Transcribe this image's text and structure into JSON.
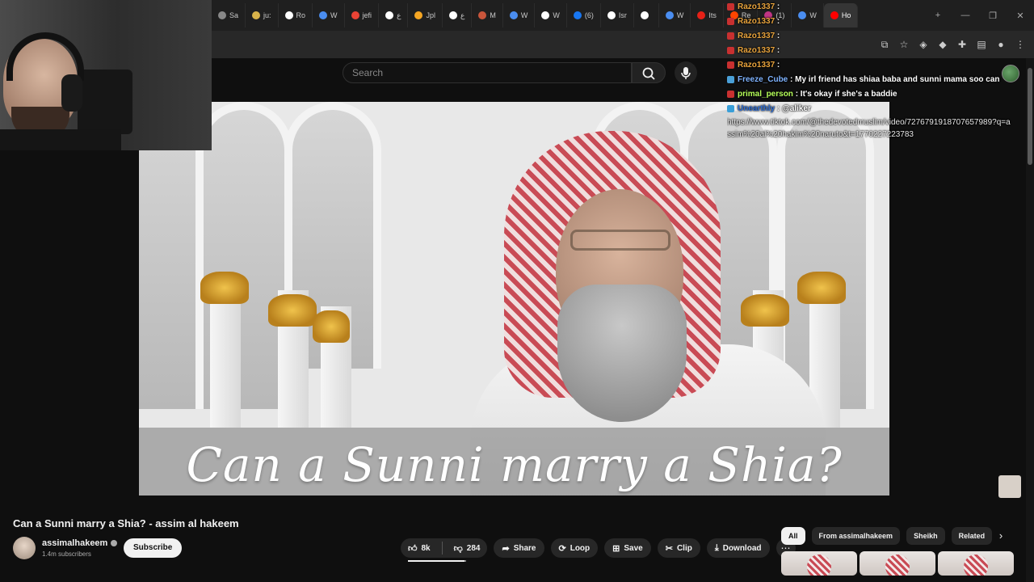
{
  "browser": {
    "tabs": [
      {
        "label": "Sa",
        "color": "#888888"
      },
      {
        "label": "ju:",
        "color": "#d9b34a"
      },
      {
        "label": "Ro",
        "color": "#ffffff",
        "icon": "x-logo"
      },
      {
        "label": "W",
        "color": "#4a8df0"
      },
      {
        "label": "jefi",
        "color": "#ea4335"
      },
      {
        "label": "ع",
        "color": "#ffffff",
        "icon": "x-logo"
      },
      {
        "label": "Jpl",
        "color": "#f5a623"
      },
      {
        "label": "ع",
        "color": "#ffffff",
        "icon": "x-logo"
      },
      {
        "label": "M",
        "color": "#c9553b"
      },
      {
        "label": "W",
        "color": "#4a8df0"
      },
      {
        "label": "W",
        "color": "#ffffff",
        "icon": "x-logo"
      },
      {
        "label": "(6)",
        "color": "#1877f2"
      },
      {
        "label": "Isr",
        "color": "#ffffff"
      },
      {
        "label": "",
        "color": "#ffffff",
        "icon": "x-logo"
      },
      {
        "label": "W",
        "color": "#4a8df0"
      },
      {
        "label": "Its",
        "color": "#e62117"
      },
      {
        "label": "Re",
        "color": "#ff4500"
      },
      {
        "label": "(1)",
        "color": "#c13584"
      },
      {
        "label": "W",
        "color": "#4a8df0"
      },
      {
        "label": "Ho",
        "color": "#ff0000"
      }
    ]
  },
  "youtube": {
    "search_placeholder": "Search"
  },
  "video": {
    "caption": "Can a Sunni marry a Shia?",
    "title": "Can a Sunni marry a Shia? - assim al hakeem"
  },
  "channel": {
    "name": "assimalhakeem",
    "subscribers": "1.4m subscribers",
    "subscribe_label": "Subscribe"
  },
  "actions": {
    "likes": "8k",
    "dislikes": "284",
    "share": "Share",
    "loop": "Loop",
    "save": "Save",
    "clip": "Clip",
    "download": "Download",
    "like_ratio": 0.966
  },
  "chips": [
    "All",
    "From assimalhakeem",
    "Sheikh",
    "Related"
  ],
  "chat": [
    {
      "user": "Razo1337",
      "color": "#e8a33c",
      "badge": "#c83030",
      "msg": ""
    },
    {
      "user": "Razo1337",
      "color": "#e8a33c",
      "badge": "#c83030",
      "msg": ""
    },
    {
      "user": "Razo1337",
      "color": "#e8a33c",
      "badge": "#c83030",
      "msg": ""
    },
    {
      "user": "Razo1337",
      "color": "#e8a33c",
      "badge": "#c83030",
      "msg": ""
    },
    {
      "user": "Razo1337",
      "color": "#e8a33c",
      "badge": "#c83030",
      "msg": ""
    },
    {
      "user": "Freeze_Cube",
      "color": "#7fb3ff",
      "badge": "#4aa0d8",
      "msg": "My irl friend has shiaa baba and sunni mama soo can"
    },
    {
      "user": "primal_person",
      "color": "#b6ff5a",
      "badge": "#c83030",
      "msg": "It's okay if she's a baddie"
    },
    {
      "user": "Unearthly",
      "color": "#2f6fd6",
      "badge": "#3a9fd8",
      "msg": "@aliker"
    }
  ],
  "chat_link": "https://www.tiktok.com/@thedevotedmuslim/video/7276791918707657989?q=assim%20al%20hakim%20naruto&t=1770227223783"
}
